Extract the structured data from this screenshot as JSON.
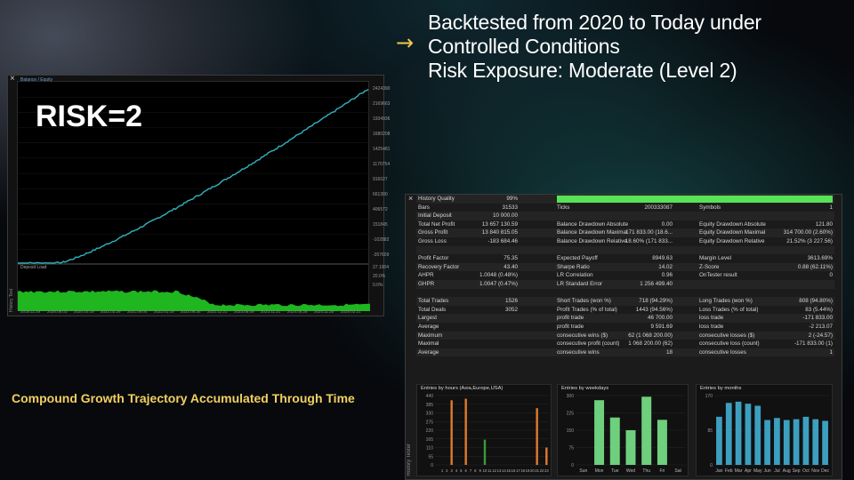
{
  "headline": {
    "arrow": "→",
    "lines": [
      "Backtested from 2020 to Today under",
      "Controlled Conditions",
      "Risk Exposure: Moderate (Level 2)"
    ]
  },
  "balance_chart": {
    "close_glyph": "×",
    "legend": "Balance / Equity",
    "overlay_text": "RISK=2",
    "deposit_label": "Deposit Load",
    "side_label": "History Test",
    "y_scale": [
      "2424390",
      "2169663",
      "1934936",
      "1680208",
      "1425481",
      "1170754",
      "916027",
      "661300",
      "406572",
      "151845",
      "-102882",
      "-357609"
    ],
    "deposit_scale": [
      "27.1904",
      "20.0%",
      "0.0%"
    ],
    "date_labels": [
      "2019.11.28",
      "2020.08.03",
      "2020.10.19",
      "2021.03.29",
      "2021.09.04",
      "2022.01.19",
      "2022.06.25",
      "2022.12.21",
      "2023.06.09",
      "2023.11.21",
      "2024.05.28",
      "2024.11.28",
      "2025.02.21"
    ],
    "colors": {
      "balance": "#2bb5a8",
      "equity": "#3fa9e0",
      "deposit": "#1fb61f"
    }
  },
  "caption": "Compound Growth Trajectory Accumulated Through Time",
  "report": {
    "close_glyph": "×",
    "side_label": "History Tester",
    "history_quality": {
      "label": "History Quality",
      "value": "99%"
    },
    "rows": [
      [
        "Bars",
        "31533",
        "Ticks",
        "200333087",
        "Symbols",
        "1"
      ],
      [
        "Initial Deposit",
        "10 000.00",
        "",
        "",
        "",
        ""
      ],
      [
        "Total Net Profit",
        "13 657 130.59",
        "Balance Drawdown Absolute",
        "0.00",
        "Equity Drawdown Absolute",
        "121.80"
      ],
      [
        "Gross Profit",
        "13 840 815.05",
        "Balance Drawdown Maximal",
        "171 833.00 (18.6...",
        "Equity Drawdown Maximal",
        "314 700.00 (2.60%)"
      ],
      [
        "Gross Loss",
        "-183 684.46",
        "Balance Drawdown Relative",
        "18.60% (171 833...",
        "Equity Drawdown Relative",
        "21.52% (3 227.56)"
      ],
      [
        "",
        "",
        "",
        "",
        "",
        ""
      ],
      [
        "Profit Factor",
        "75.35",
        "Expected Payoff",
        "8949.63",
        "Margin Level",
        "3613.69%"
      ],
      [
        "Recovery Factor",
        "43.40",
        "Sharpe Ratio",
        "14.02",
        "Z-Score",
        "0.88 (62.11%)"
      ],
      [
        "AHPR",
        "1.0048 (0.48%)",
        "LR Correlation",
        "0.96",
        "OnTester result",
        "0"
      ],
      [
        "GHPR",
        "1.0047 (0.47%)",
        "LR Standard Error",
        "1 256 499.40",
        "",
        ""
      ],
      [
        "",
        "",
        "",
        "",
        "",
        ""
      ],
      [
        "Total Trades",
        "1526",
        "Short Trades (won %)",
        "718 (94.29%)",
        "Long Trades (won %)",
        "808 (94.80%)"
      ],
      [
        "Total Deals",
        "3052",
        "Profit Trades (% of total)",
        "1443 (94.56%)",
        "Loss Trades (% of total)",
        "83 (5.44%)"
      ],
      [
        "Largest",
        "",
        "profit trade",
        "46 700.00",
        "loss trade",
        "-171 833.00"
      ],
      [
        "Average",
        "",
        "profit trade",
        "9 591.69",
        "loss trade",
        "-2 213.07"
      ],
      [
        "Maximum",
        "",
        "consecutive wins ($)",
        "62 (1 068 200.00)",
        "consecutive losses ($)",
        "2 (-24.57)"
      ],
      [
        "Maximal",
        "",
        "consecutive profit (count)",
        "1 068 200.00 (62)",
        "consecutive loss (count)",
        "-171 833.00 (1)"
      ],
      [
        "Average",
        "",
        "consecutive wins",
        "18",
        "consecutive losses",
        "1"
      ]
    ],
    "histograms": [
      {
        "title": "Entries by hours (Asia,Europe,USA)",
        "y_ticks": [
          "440",
          "385",
          "330",
          "275",
          "220",
          "165",
          "110",
          "55",
          "0"
        ],
        "ylim": [
          0,
          440
        ],
        "categories": [
          "0",
          "1",
          "2",
          "3",
          "4",
          "5",
          "6",
          "7",
          "8",
          "9",
          "10",
          "11",
          "12",
          "13",
          "14",
          "15",
          "16",
          "17",
          "18",
          "19",
          "20",
          "21",
          "22",
          "23"
        ],
        "x_labels": [
          "1",
          "2",
          "3",
          "4",
          "5",
          "6",
          "7",
          "8",
          "9",
          "10",
          "11",
          "12",
          "13",
          "14",
          "15",
          "16",
          "17",
          "18",
          "19",
          "20",
          "21",
          "22",
          "23"
        ],
        "values": [
          0,
          0,
          0,
          410,
          0,
          0,
          420,
          0,
          0,
          0,
          160,
          0,
          0,
          0,
          0,
          0,
          0,
          0,
          0,
          0,
          0,
          360,
          0,
          110
        ],
        "bar_colors": [
          "#e07a2e",
          "#e07a2e",
          "#e07a2e",
          "#e07a2e",
          "#e07a2e",
          "#e07a2e",
          "#e07a2e",
          "#e07a2e",
          "#3a9a3a",
          "#3a9a3a",
          "#3a9a3a",
          "#3a9a3a",
          "#3a9a3a",
          "#3a9a3a",
          "#3a9a3a",
          "#3a9a3a",
          "#e07a2e",
          "#e07a2e",
          "#e07a2e",
          "#e07a2e",
          "#e07a2e",
          "#e07a2e",
          "#e07a2e",
          "#e07a2e"
        ]
      },
      {
        "title": "Entries by weekdays",
        "y_ticks": [
          "300",
          "225",
          "150",
          "75",
          "0"
        ],
        "ylim": [
          0,
          300
        ],
        "categories": [
          "Sun",
          "Mon",
          "Tue",
          "Wed",
          "Thu",
          "Fri",
          "Sat"
        ],
        "x_labels": [
          "Sun",
          "Mon",
          "Tue",
          "Wed",
          "Thu",
          "Fri",
          "Sat"
        ],
        "values": [
          0,
          280,
          205,
          150,
          295,
          195,
          0
        ],
        "bar_colors": [
          "#6ecf7c",
          "#6ecf7c",
          "#6ecf7c",
          "#6ecf7c",
          "#6ecf7c",
          "#6ecf7c",
          "#6ecf7c"
        ]
      },
      {
        "title": "Entries by months",
        "y_ticks": [
          "170",
          "85",
          "0"
        ],
        "ylim": [
          0,
          170
        ],
        "categories": [
          "Jan",
          "Feb",
          "Mar",
          "Apr",
          "May",
          "Jun",
          "Jul",
          "Aug",
          "Sep",
          "Oct",
          "Nov",
          "Dec"
        ],
        "x_labels": [
          "Jan",
          "Feb",
          "Mar",
          "Apr",
          "May",
          "Jun",
          "Jul",
          "Aug",
          "Sep",
          "Oct",
          "Nov",
          "Dec"
        ],
        "values": [
          118,
          152,
          155,
          150,
          145,
          110,
          115,
          110,
          112,
          118,
          112,
          108
        ],
        "bar_colors": [
          "#3d9fc0",
          "#3d9fc0",
          "#3d9fc0",
          "#3d9fc0",
          "#3d9fc0",
          "#3d9fc0",
          "#3d9fc0",
          "#3d9fc0",
          "#3d9fc0",
          "#3d9fc0",
          "#3d9fc0",
          "#3d9fc0"
        ]
      }
    ]
  }
}
